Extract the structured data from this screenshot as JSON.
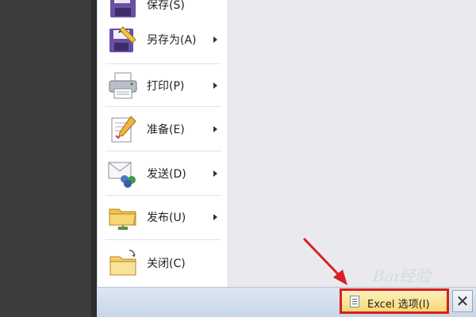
{
  "menu": {
    "items": [
      {
        "label": "保存(S)",
        "icon": "save-icon",
        "has_submenu": false
      },
      {
        "label": "另存为(A)",
        "icon": "save-as-icon",
        "has_submenu": true
      },
      {
        "label": "打印(P)",
        "icon": "printer-icon",
        "has_submenu": true
      },
      {
        "label": "准备(E)",
        "icon": "prepare-document-icon",
        "has_submenu": true
      },
      {
        "label": "发送(D)",
        "icon": "send-icon",
        "has_submenu": true
      },
      {
        "label": "发布(U)",
        "icon": "publish-folder-icon",
        "has_submenu": true
      },
      {
        "label": "关闭(C)",
        "icon": "close-folder-icon",
        "has_submenu": false
      }
    ]
  },
  "footer": {
    "options_label": "Excel 选项(I)",
    "exit_symbol": "✕"
  },
  "watermark": {
    "text": "Bai经验"
  },
  "colors": {
    "highlight_border": "#d82020",
    "annotation_arrow": "#d82020",
    "options_button_fill": "#f6d874"
  }
}
